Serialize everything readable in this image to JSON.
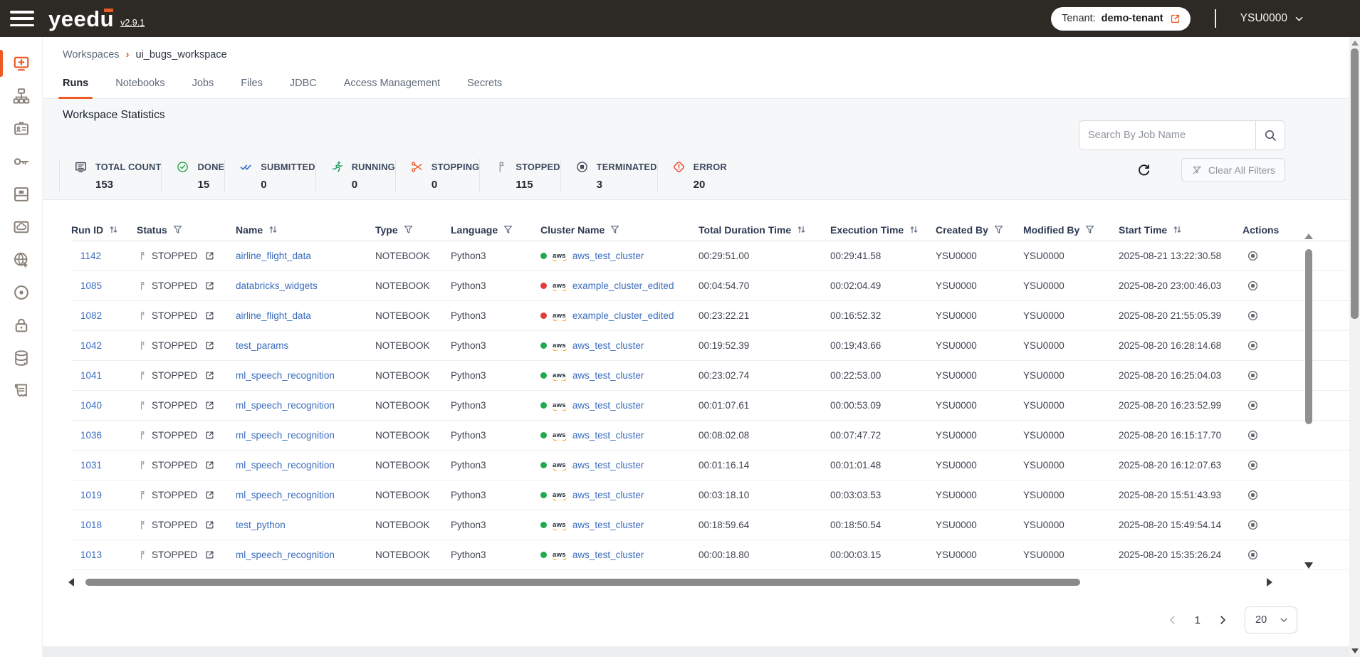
{
  "header": {
    "app_name": "yeedu",
    "version": "v2.9.1",
    "tenant_label": "Tenant:",
    "tenant_name": "demo-tenant",
    "username": "YSU0000"
  },
  "sidebar": {
    "active_item": "workspaces",
    "items": [
      "workspaces",
      "clusters",
      "jobs-badge",
      "access-keys",
      "storage-shelf",
      "cloud",
      "network-globe",
      "disc-target",
      "security-lock",
      "database",
      "audit-logs"
    ]
  },
  "breadcrumb": {
    "root": "Workspaces",
    "separator": "›",
    "current": "ui_bugs_workspace"
  },
  "tabs": [
    {
      "label": "Runs",
      "state": "active"
    },
    {
      "label": "Notebooks",
      "state": ""
    },
    {
      "label": "Jobs",
      "state": ""
    },
    {
      "label": "Files",
      "state": ""
    },
    {
      "label": "JDBC",
      "state": ""
    },
    {
      "label": "Access Management",
      "state": ""
    },
    {
      "label": "Secrets",
      "state": ""
    }
  ],
  "stats": {
    "title": "Workspace Statistics",
    "tiles": [
      {
        "icon": "ic-total",
        "width": "w-total",
        "sym": "#sym-total",
        "label": "TOTAL COUNT",
        "value": "153"
      },
      {
        "icon": "ic-done",
        "width": "w-done",
        "sym": "#sym-done",
        "label": "DONE",
        "value": "15"
      },
      {
        "icon": "ic-submitted",
        "width": "w-submitted",
        "sym": "#sym-submitted",
        "label": "SUBMITTED",
        "value": "0"
      },
      {
        "icon": "ic-running",
        "width": "w-running",
        "sym": "#sym-running",
        "label": "RUNNING",
        "value": "0"
      },
      {
        "icon": "ic-stopping",
        "width": "w-stopping",
        "sym": "#sym-stopping",
        "label": "STOPPING",
        "value": "0"
      },
      {
        "icon": "ic-stopped",
        "width": "w-stopped",
        "sym": "#sym-stopped",
        "label": "STOPPED",
        "value": "115"
      },
      {
        "icon": "ic-terminated",
        "width": "w-terminated",
        "sym": "#sym-terminated",
        "label": "TERMINATED",
        "value": "3"
      },
      {
        "icon": "ic-error",
        "width": "w-error",
        "sym": "#sym-error",
        "label": "ERROR",
        "value": "20"
      }
    ]
  },
  "search": {
    "placeholder": "Search By Job Name"
  },
  "toolbar": {
    "clear_filters_label": "Clear All Filters"
  },
  "icons": {
    "aws_logo_text": "aws"
  },
  "table": {
    "columns": [
      {
        "label": "Run ID",
        "control": "sort"
      },
      {
        "label": "Status",
        "control": "filter"
      },
      {
        "label": "Name",
        "control": "sort"
      },
      {
        "label": "Type",
        "control": "filter"
      },
      {
        "label": "Language",
        "control": "filter"
      },
      {
        "label": "Cluster Name",
        "control": "filter"
      },
      {
        "label": "Total Duration Time",
        "control": "sort"
      },
      {
        "label": "Execution Time",
        "control": "sort"
      },
      {
        "label": "Created By",
        "control": "filter"
      },
      {
        "label": "Modified By",
        "control": "filter"
      },
      {
        "label": "Start Time",
        "control": "sort"
      },
      {
        "label": "Actions",
        "control": ""
      }
    ],
    "rows": [
      {
        "run_id": "1142",
        "status": "STOPPED",
        "name": "airline_flight_data",
        "type": "NOTEBOOK",
        "language": "Python3",
        "cluster_status": "green",
        "cluster": "aws_test_cluster",
        "duration": "00:29:51.00",
        "execution": "00:29:41.58",
        "created_by": "YSU0000",
        "modified_by": "YSU0000",
        "start_time": "2025-08-21 13:22:30.58"
      },
      {
        "run_id": "1085",
        "status": "STOPPED",
        "name": "databricks_widgets",
        "type": "NOTEBOOK",
        "language": "Python3",
        "cluster_status": "red",
        "cluster": "example_cluster_edited",
        "duration": "00:04:54.70",
        "execution": "00:02:04.49",
        "created_by": "YSU0000",
        "modified_by": "YSU0000",
        "start_time": "2025-08-20 23:00:46.03"
      },
      {
        "run_id": "1082",
        "status": "STOPPED",
        "name": "airline_flight_data",
        "type": "NOTEBOOK",
        "language": "Python3",
        "cluster_status": "red",
        "cluster": "example_cluster_edited",
        "duration": "00:23:22.21",
        "execution": "00:16:52.32",
        "created_by": "YSU0000",
        "modified_by": "YSU0000",
        "start_time": "2025-08-20 21:55:05.39"
      },
      {
        "run_id": "1042",
        "status": "STOPPED",
        "name": "test_params",
        "type": "NOTEBOOK",
        "language": "Python3",
        "cluster_status": "green",
        "cluster": "aws_test_cluster",
        "duration": "00:19:52.39",
        "execution": "00:19:43.66",
        "created_by": "YSU0000",
        "modified_by": "YSU0000",
        "start_time": "2025-08-20 16:28:14.68"
      },
      {
        "run_id": "1041",
        "status": "STOPPED",
        "name": "ml_speech_recognition",
        "type": "NOTEBOOK",
        "language": "Python3",
        "cluster_status": "green",
        "cluster": "aws_test_cluster",
        "duration": "00:23:02.74",
        "execution": "00:22:53.00",
        "created_by": "YSU0000",
        "modified_by": "YSU0000",
        "start_time": "2025-08-20 16:25:04.03"
      },
      {
        "run_id": "1040",
        "status": "STOPPED",
        "name": "ml_speech_recognition",
        "type": "NOTEBOOK",
        "language": "Python3",
        "cluster_status": "green",
        "cluster": "aws_test_cluster",
        "duration": "00:01:07.61",
        "execution": "00:00:53.09",
        "created_by": "YSU0000",
        "modified_by": "YSU0000",
        "start_time": "2025-08-20 16:23:52.99"
      },
      {
        "run_id": "1036",
        "status": "STOPPED",
        "name": "ml_speech_recognition",
        "type": "NOTEBOOK",
        "language": "Python3",
        "cluster_status": "green",
        "cluster": "aws_test_cluster",
        "duration": "00:08:02.08",
        "execution": "00:07:47.72",
        "created_by": "YSU0000",
        "modified_by": "YSU0000",
        "start_time": "2025-08-20 16:15:17.70"
      },
      {
        "run_id": "1031",
        "status": "STOPPED",
        "name": "ml_speech_recognition",
        "type": "NOTEBOOK",
        "language": "Python3",
        "cluster_status": "green",
        "cluster": "aws_test_cluster",
        "duration": "00:01:16.14",
        "execution": "00:01:01.48",
        "created_by": "YSU0000",
        "modified_by": "YSU0000",
        "start_time": "2025-08-20 16:12:07.63"
      },
      {
        "run_id": "1019",
        "status": "STOPPED",
        "name": "ml_speech_recognition",
        "type": "NOTEBOOK",
        "language": "Python3",
        "cluster_status": "green",
        "cluster": "aws_test_cluster",
        "duration": "00:03:18.10",
        "execution": "00:03:03.53",
        "created_by": "YSU0000",
        "modified_by": "YSU0000",
        "start_time": "2025-08-20 15:51:43.93"
      },
      {
        "run_id": "1018",
        "status": "STOPPED",
        "name": "test_python",
        "type": "NOTEBOOK",
        "language": "Python3",
        "cluster_status": "green",
        "cluster": "aws_test_cluster",
        "duration": "00:18:59.64",
        "execution": "00:18:50.54",
        "created_by": "YSU0000",
        "modified_by": "YSU0000",
        "start_time": "2025-08-20 15:49:54.14"
      },
      {
        "run_id": "1013",
        "status": "STOPPED",
        "name": "ml_speech_recognition",
        "type": "NOTEBOOK",
        "language": "Python3",
        "cluster_status": "green",
        "cluster": "aws_test_cluster",
        "duration": "00:00:18.80",
        "execution": "00:00:03.15",
        "created_by": "YSU0000",
        "modified_by": "YSU0000",
        "start_time": "2025-08-20 15:35:26.24"
      }
    ]
  },
  "pagination": {
    "page": "1",
    "page_size": "20"
  },
  "colors": {
    "accent": "#ed5a24",
    "topbar_bg": "#2d2925",
    "link_blue": "#3b6dbf",
    "green_dot": "#21a94f",
    "red_dot": "#e23d3d"
  }
}
